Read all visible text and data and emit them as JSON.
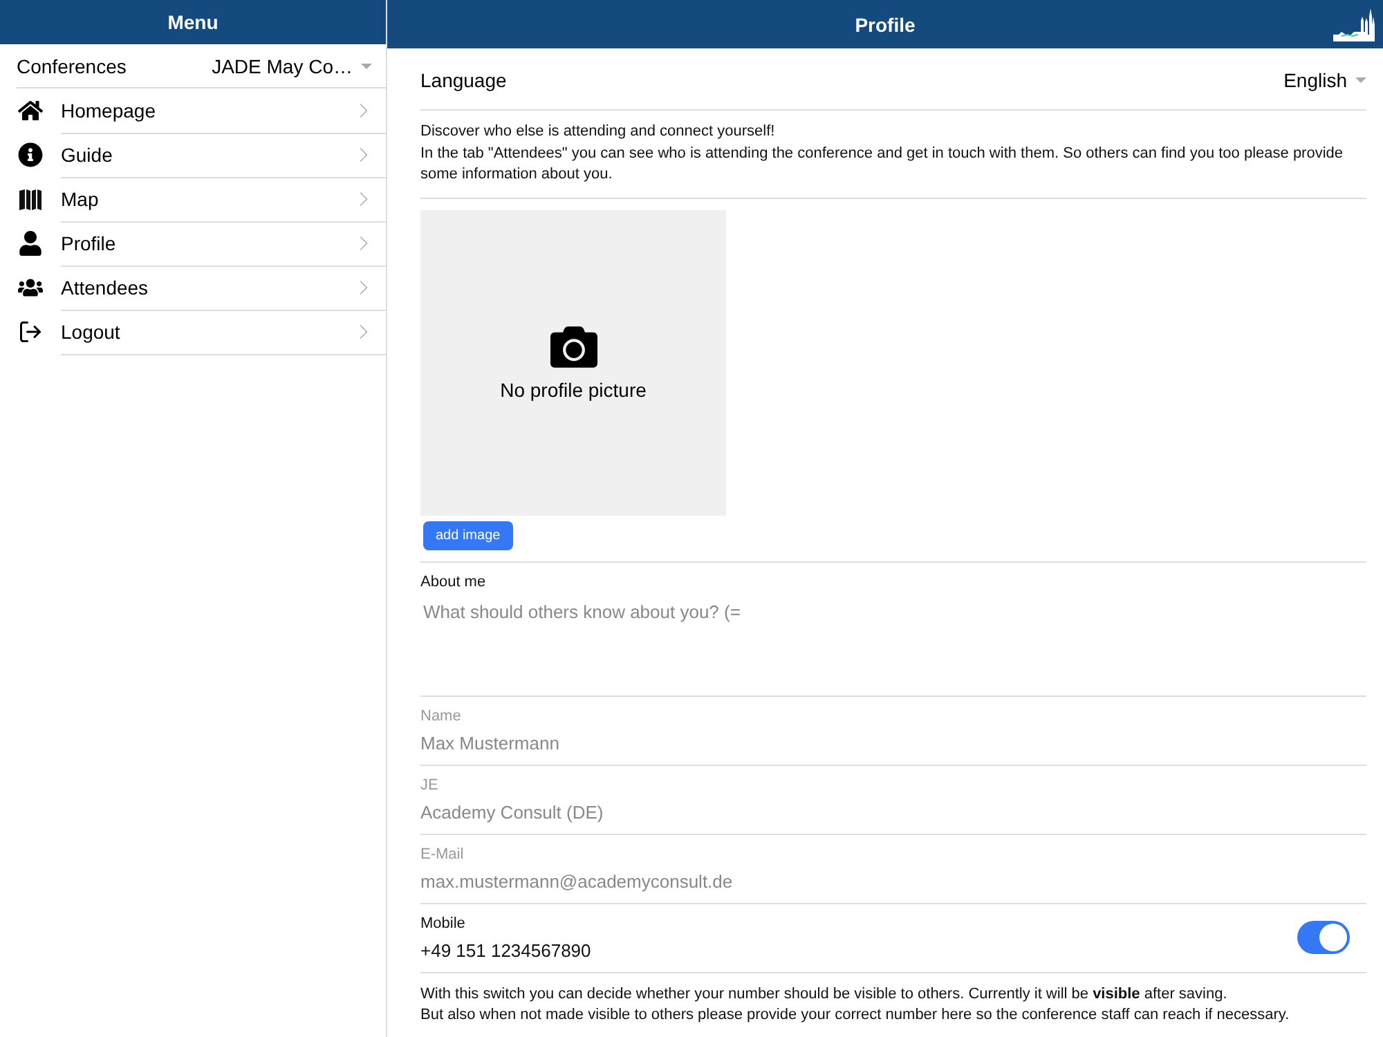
{
  "sidebar": {
    "title": "Menu",
    "conference": {
      "label": "Conferences",
      "value": "JADE May Co…"
    },
    "items": [
      {
        "label": "Homepage",
        "selected": false
      },
      {
        "label": "Guide",
        "selected": false
      },
      {
        "label": "Map",
        "selected": false
      },
      {
        "label": "Profile",
        "selected": false
      },
      {
        "label": "Attendees",
        "selected": false
      },
      {
        "label": "Logout",
        "selected": false
      }
    ]
  },
  "header": {
    "title": "Profile"
  },
  "language": {
    "label": "Language",
    "value": "English"
  },
  "intro": [
    "Discover who else is attending and connect yourself!",
    "In the tab \"Attendees\" you can see who is attending the conference and get in touch with them. So others can find you too please provide some information about you."
  ],
  "picture": {
    "caption": "No profile picture",
    "button": "add image"
  },
  "about": {
    "label": "About me",
    "placeholder": "What should others know about you? (="
  },
  "fields": [
    {
      "label": "Name",
      "placeholder": "Max Mustermann"
    },
    {
      "label": "JE",
      "placeholder": "Academy Consult (DE)"
    },
    {
      "label": "E-Mail",
      "placeholder": "max.mustermann@academyconsult.de"
    }
  ],
  "mobile": {
    "label": "Mobile",
    "value": "+49 151 1234567890",
    "visible": true
  },
  "note": [
    "With this switch you can decide whether your number should be visible to others. Currently it will be **visible** after saving.",
    "But also when not made visible to others please provide your correct number here so the conference staff can reach if necessary."
  ]
}
